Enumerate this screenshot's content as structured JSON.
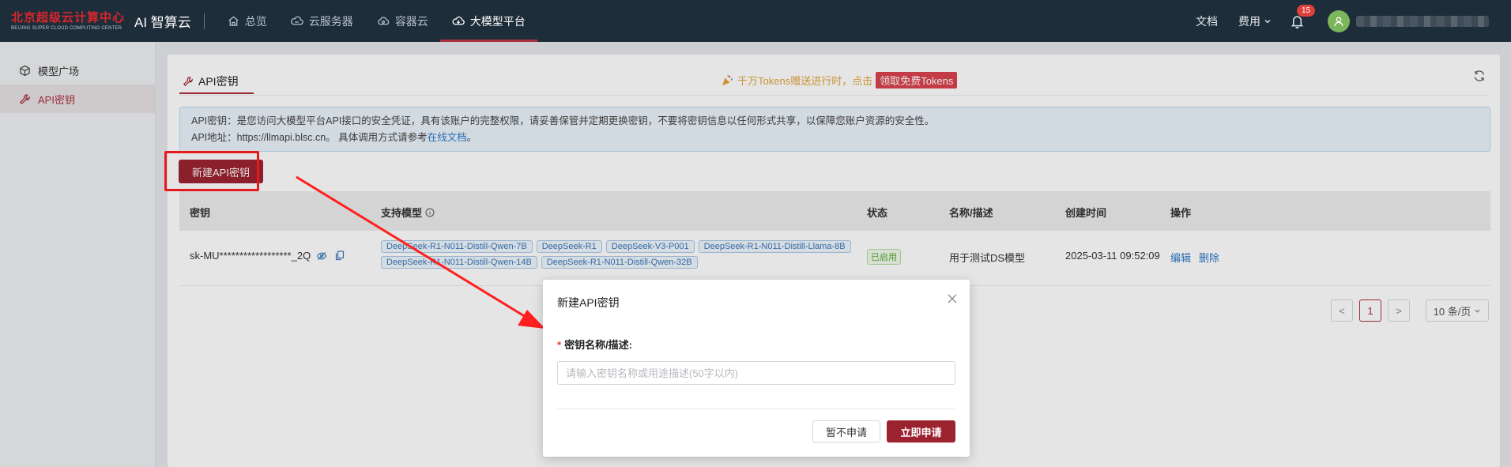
{
  "brand": {
    "logo_cn": "北京超级云计算中心",
    "logo_en": "BEIJING SUPER CLOUD COMPUTING CENTER",
    "app_title": "AI 智算云"
  },
  "nav": {
    "items": [
      {
        "label": "总览",
        "icon": "home-icon"
      },
      {
        "label": "云服务器",
        "icon": "server-icon"
      },
      {
        "label": "容器云",
        "icon": "cloud-icon"
      },
      {
        "label": "大模型平台",
        "icon": "cloud-model-icon",
        "active": true
      }
    ]
  },
  "topbar": {
    "docs_label": "文档",
    "billing_label": "费用",
    "notification_count": "15"
  },
  "sidebar": {
    "items": [
      {
        "label": "模型广场",
        "icon": "cube-icon"
      },
      {
        "label": "API密钥",
        "icon": "wrench-icon",
        "active": true
      }
    ]
  },
  "main": {
    "tab_label": "API密钥",
    "promo_text": "千万Tokens赠送进行时，点击",
    "promo_button": "领取免费Tokens",
    "notice_line1": "API密钥：是您访问大模型平台API接口的安全凭证，具有该账户的完整权限，请妥善保管并定期更换密钥，不要将密钥信息以任何形式共享，以保障您账户资源的安全性。",
    "notice_line2_prefix": "API地址：https://llmapi.blsc.cn。 具体调用方式请参考",
    "notice_link": "在线文档",
    "notice_line2_suffix": "。",
    "create_button": "新建API密钥"
  },
  "table": {
    "headers": {
      "key": "密钥",
      "models": "支持模型",
      "status": "状态",
      "desc": "名称/描述",
      "created": "创建时间",
      "ops": "操作"
    },
    "rows": [
      {
        "key": "sk-MU******************_2Q",
        "models": [
          "DeepSeek-R1-N011-Distill-Qwen-7B",
          "DeepSeek-R1",
          "DeepSeek-V3-P001",
          "DeepSeek-R1-N011-Distill-Llama-8B",
          "DeepSeek-R1-N011-Distill-Qwen-14B",
          "DeepSeek-R1-N011-Distill-Qwen-32B"
        ],
        "status": "已启用",
        "desc": "用于测试DS模型",
        "created": "2025-03-11 09:52:09",
        "edit": "编辑",
        "delete": "删除"
      }
    ]
  },
  "pagination": {
    "prev": "<",
    "current": "1",
    "next": ">",
    "page_size": "10 条/页"
  },
  "modal": {
    "title": "新建API密钥",
    "field_label": "密钥名称/描述:",
    "field_placeholder": "请输入密钥名称或用途描述(50字以内)",
    "field_value": "",
    "cancel_button": "暂不申请",
    "confirm_button": "立即申请"
  },
  "colors": {
    "brand_red": "#9b2330",
    "nav_bg": "#1e2d3a",
    "annotation_red": "#ff1f1f",
    "link_blue": "#2c78c6"
  }
}
